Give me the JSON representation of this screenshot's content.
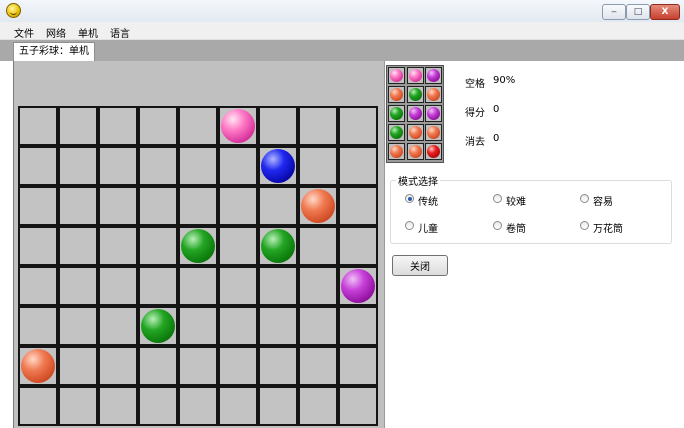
{
  "window": {
    "app_icon": "smiley-icon",
    "controls": {
      "minimize": "‒",
      "maximize": "□",
      "close": "X"
    }
  },
  "menu": [
    {
      "label": "文件"
    },
    {
      "label": "网络"
    },
    {
      "label": "单机"
    },
    {
      "label": "语言"
    }
  ],
  "tab": {
    "label": "五子彩球：单机"
  },
  "board": {
    "cols": 9,
    "rows": 8,
    "balls": [
      {
        "row": 0,
        "col": 5,
        "color": "pink"
      },
      {
        "row": 1,
        "col": 6,
        "color": "blue"
      },
      {
        "row": 2,
        "col": 7,
        "color": "orange"
      },
      {
        "row": 3,
        "col": 4,
        "color": "green"
      },
      {
        "row": 3,
        "col": 6,
        "color": "green"
      },
      {
        "row": 4,
        "col": 8,
        "color": "purple"
      },
      {
        "row": 5,
        "col": 3,
        "color": "green"
      },
      {
        "row": 6,
        "col": 0,
        "color": "orange"
      }
    ]
  },
  "preview": {
    "rows": [
      [
        "pink",
        "pink",
        "purple"
      ],
      [
        "orange",
        "green",
        "orange"
      ],
      [
        "green",
        "purple",
        "purple"
      ],
      [
        "green",
        "orange",
        "orange"
      ],
      [
        "orange",
        "orange",
        "red"
      ]
    ]
  },
  "stats": {
    "space_label": "空格",
    "space_value": "90%",
    "score_label": "得分",
    "score_value": "0",
    "cleared_label": "消去",
    "cleared_value": "0"
  },
  "mode": {
    "title": "模式选择",
    "options": [
      {
        "label": "传统",
        "checked": true
      },
      {
        "label": "较难",
        "checked": false
      },
      {
        "label": "容易",
        "checked": false
      },
      {
        "label": "儿童",
        "checked": false
      },
      {
        "label": "卷筒",
        "checked": false
      },
      {
        "label": "万花筒",
        "checked": false
      }
    ]
  },
  "close_button": {
    "label": "关闭"
  }
}
